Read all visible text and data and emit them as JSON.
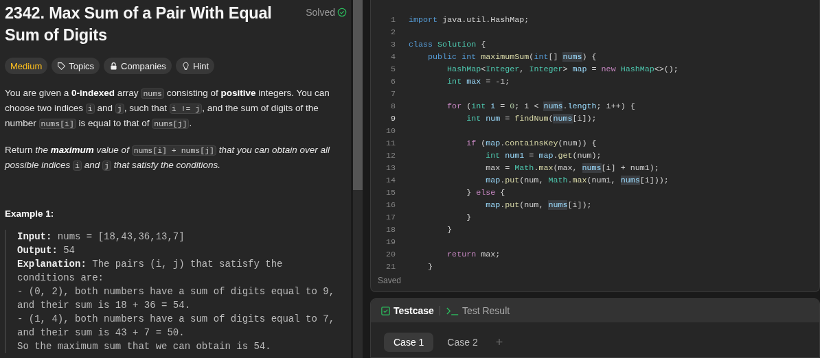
{
  "problem": {
    "title": "2342. Max Sum of a Pair With Equal Sum of Digits",
    "status": "Solved",
    "solved": true,
    "tags": [
      {
        "kind": "difficulty",
        "label": "Medium"
      },
      {
        "kind": "topics",
        "label": "Topics"
      },
      {
        "kind": "companies",
        "label": "Companies"
      },
      {
        "kind": "hint",
        "label": "Hint"
      }
    ],
    "paragraphs": [
      [
        {
          "kind": "text",
          "text": "You are given a **0-indexed** array "
        },
        {
          "kind": "code",
          "text": "nums"
        },
        {
          "kind": "text",
          "text": " consisting of **positive** integers. You can choose two indices "
        },
        {
          "kind": "code",
          "text": "i"
        },
        {
          "kind": "text",
          "text": " and "
        },
        {
          "kind": "code",
          "text": "j"
        },
        {
          "kind": "text",
          "text": ", such that "
        },
        {
          "kind": "code",
          "text": "i != j"
        },
        {
          "kind": "text",
          "text": ", and the sum of digits of the number "
        },
        {
          "kind": "code",
          "text": "nums[i]"
        },
        {
          "kind": "text",
          "text": " is equal to that of "
        },
        {
          "kind": "code",
          "text": "nums[j]"
        },
        {
          "kind": "text",
          "text": "."
        }
      ],
      [
        {
          "kind": "text",
          "text": "Return "
        },
        {
          "kind": "em",
          "text": "the **maximum** value of "
        },
        {
          "kind": "code",
          "text": "nums[i] + nums[j]"
        },
        {
          "kind": "em",
          "text": " that you can obtain over all possible indices "
        },
        {
          "kind": "code",
          "text": "i"
        },
        {
          "kind": "em",
          "text": " and "
        },
        {
          "kind": "code",
          "text": "j"
        },
        {
          "kind": "em",
          "text": " that satisfy the conditions."
        }
      ]
    ],
    "example": {
      "title": "Example 1:",
      "lines": [
        {
          "label": "Input:",
          "text": "nums = [18,43,36,13,7]"
        },
        {
          "label": "Output:",
          "text": "54"
        },
        {
          "label": "Explanation:",
          "text": "The pairs (i, j) that satisfy the\nconditions are:\n- (0, 2), both numbers have a sum of digits equal to 9,\nand their sum is 18 + 36 = 54.\n- (1, 4), both numbers have a sum of digits equal to 7,\nand their sum is 43 + 7 = 50.\nSo the maximum sum that we can obtain is 54."
        }
      ]
    }
  },
  "editor": {
    "status": "Saved",
    "lines": [
      {
        "number": "1",
        "current": false,
        "tokens": [
          {
            "kind": "kw",
            "t": "import"
          },
          {
            "kind": "p",
            "t": " java.util.HashMap;"
          }
        ]
      },
      {
        "number": "2",
        "current": false
      },
      {
        "number": "3",
        "current": false,
        "tokens": [
          {
            "kind": "kw",
            "t": "class"
          },
          {
            "kind": "type",
            "t": " Solution"
          },
          {
            "kind": "p",
            "t": " {"
          }
        ]
      },
      {
        "number": "4",
        "current": false,
        "tokens": [
          {
            "kind": "kw",
            "t": "    public"
          },
          {
            "kind": "kw",
            "t": " int"
          },
          {
            "kind": "fn",
            "t": " maximumSum"
          },
          {
            "kind": "p",
            "t": "("
          },
          {
            "kind": "kw",
            "t": "int"
          },
          {
            "kind": "p",
            "t": "[] "
          },
          {
            "kind": "hl",
            "t": "nums"
          },
          {
            "kind": "p",
            "t": ") {"
          }
        ]
      },
      {
        "number": "5",
        "current": false,
        "tokens": [
          {
            "kind": "type",
            "t": "        HashMap"
          },
          {
            "kind": "p",
            "t": "<"
          },
          {
            "kind": "type",
            "t": "Integer"
          },
          {
            "kind": "p",
            "t": ", "
          },
          {
            "kind": "type",
            "t": "Integer"
          },
          {
            "kind": "p",
            "t": "> "
          },
          {
            "kind": "var",
            "t": "map"
          },
          {
            "kind": "p",
            "t": " = "
          },
          {
            "kind": "ctl",
            "t": "new"
          },
          {
            "kind": "type",
            "t": " HashMap"
          },
          {
            "kind": "p",
            "t": "<>();"
          }
        ]
      },
      {
        "number": "6",
        "current": false,
        "tokens": [
          {
            "kind": "type",
            "t": "        int"
          },
          {
            "kind": "var",
            "t": " max"
          },
          {
            "kind": "p",
            "t": " = -1;"
          }
        ]
      },
      {
        "number": "7",
        "current": false
      },
      {
        "number": "8",
        "current": false,
        "tokens": [
          {
            "kind": "ctl",
            "t": "        for"
          },
          {
            "kind": "p",
            "t": " ("
          },
          {
            "kind": "type",
            "t": "int"
          },
          {
            "kind": "var",
            "t": " i"
          },
          {
            "kind": "p",
            "t": " = "
          },
          {
            "kind": "num",
            "t": "0"
          },
          {
            "kind": "p",
            "t": "; i < "
          },
          {
            "kind": "hl",
            "t": "nums"
          },
          {
            "kind": "p",
            "t": "."
          },
          {
            "kind": "var",
            "t": "length"
          },
          {
            "kind": "p",
            "t": "; i++) {"
          }
        ]
      },
      {
        "number": "9",
        "current": true,
        "tokens": [
          {
            "kind": "type",
            "t": "            int"
          },
          {
            "kind": "var",
            "t": " num"
          },
          {
            "kind": "p",
            "t": " = "
          },
          {
            "kind": "fn",
            "t": "findNum"
          },
          {
            "kind": "p",
            "t": "("
          },
          {
            "kind": "hl",
            "t": "nums"
          },
          {
            "kind": "p",
            "t": "[i]);"
          }
        ]
      },
      {
        "number": "10",
        "current": false
      },
      {
        "number": "11",
        "current": false,
        "tokens": [
          {
            "kind": "ctl",
            "t": "            if"
          },
          {
            "kind": "p",
            "t": " ("
          },
          {
            "kind": "var",
            "t": "map"
          },
          {
            "kind": "p",
            "t": "."
          },
          {
            "kind": "fn",
            "t": "containsKey"
          },
          {
            "kind": "p",
            "t": "(num)) {"
          }
        ]
      },
      {
        "number": "12",
        "current": false,
        "tokens": [
          {
            "kind": "type",
            "t": "                int"
          },
          {
            "kind": "var",
            "t": " num1"
          },
          {
            "kind": "p",
            "t": " = "
          },
          {
            "kind": "var",
            "t": "map"
          },
          {
            "kind": "p",
            "t": "."
          },
          {
            "kind": "fn",
            "t": "get"
          },
          {
            "kind": "p",
            "t": "(num);"
          }
        ]
      },
      {
        "number": "13",
        "current": false,
        "tokens": [
          {
            "kind": "p",
            "t": "                max = "
          },
          {
            "kind": "type",
            "t": "Math"
          },
          {
            "kind": "p",
            "t": "."
          },
          {
            "kind": "fn",
            "t": "max"
          },
          {
            "kind": "p",
            "t": "(max, "
          },
          {
            "kind": "hl",
            "t": "nums"
          },
          {
            "kind": "p",
            "t": "[i] + num1);"
          }
        ]
      },
      {
        "number": "14",
        "current": false,
        "tokens": [
          {
            "kind": "var",
            "t": "                map"
          },
          {
            "kind": "p",
            "t": "."
          },
          {
            "kind": "fn",
            "t": "put"
          },
          {
            "kind": "p",
            "t": "(num, "
          },
          {
            "kind": "type",
            "t": "Math"
          },
          {
            "kind": "p",
            "t": "."
          },
          {
            "kind": "fn",
            "t": "max"
          },
          {
            "kind": "p",
            "t": "(num1, "
          },
          {
            "kind": "hl",
            "t": "nums"
          },
          {
            "kind": "p",
            "t": "[i]));"
          }
        ]
      },
      {
        "number": "15",
        "current": false,
        "tokens": [
          {
            "kind": "p",
            "t": "            } "
          },
          {
            "kind": "ctl",
            "t": "else"
          },
          {
            "kind": "p",
            "t": " {"
          }
        ]
      },
      {
        "number": "16",
        "current": false,
        "tokens": [
          {
            "kind": "var",
            "t": "                map"
          },
          {
            "kind": "p",
            "t": "."
          },
          {
            "kind": "fn",
            "t": "put"
          },
          {
            "kind": "p",
            "t": "(num, "
          },
          {
            "kind": "hl",
            "t": "nums"
          },
          {
            "kind": "p",
            "t": "[i]);"
          }
        ]
      },
      {
        "number": "17",
        "current": false,
        "tokens": [
          {
            "kind": "p",
            "t": "            }"
          }
        ]
      },
      {
        "number": "18",
        "current": false,
        "tokens": [
          {
            "kind": "p",
            "t": "        }"
          }
        ]
      },
      {
        "number": "19",
        "current": false
      },
      {
        "number": "20",
        "current": false,
        "tokens": [
          {
            "kind": "ctl",
            "t": "        return"
          },
          {
            "kind": "p",
            "t": " max;"
          }
        ]
      },
      {
        "number": "21",
        "current": false,
        "tokens": [
          {
            "kind": "p",
            "t": "    }"
          }
        ]
      }
    ]
  },
  "testpanel": {
    "tabs": [
      {
        "kind": "testcase",
        "label": "Testcase",
        "selected": true
      },
      {
        "kind": "result",
        "label": "Test Result",
        "selected": false
      }
    ],
    "cases": [
      {
        "label": "Case 1",
        "selected": true
      },
      {
        "label": "Case 2",
        "selected": false
      }
    ],
    "add_label": "+"
  }
}
